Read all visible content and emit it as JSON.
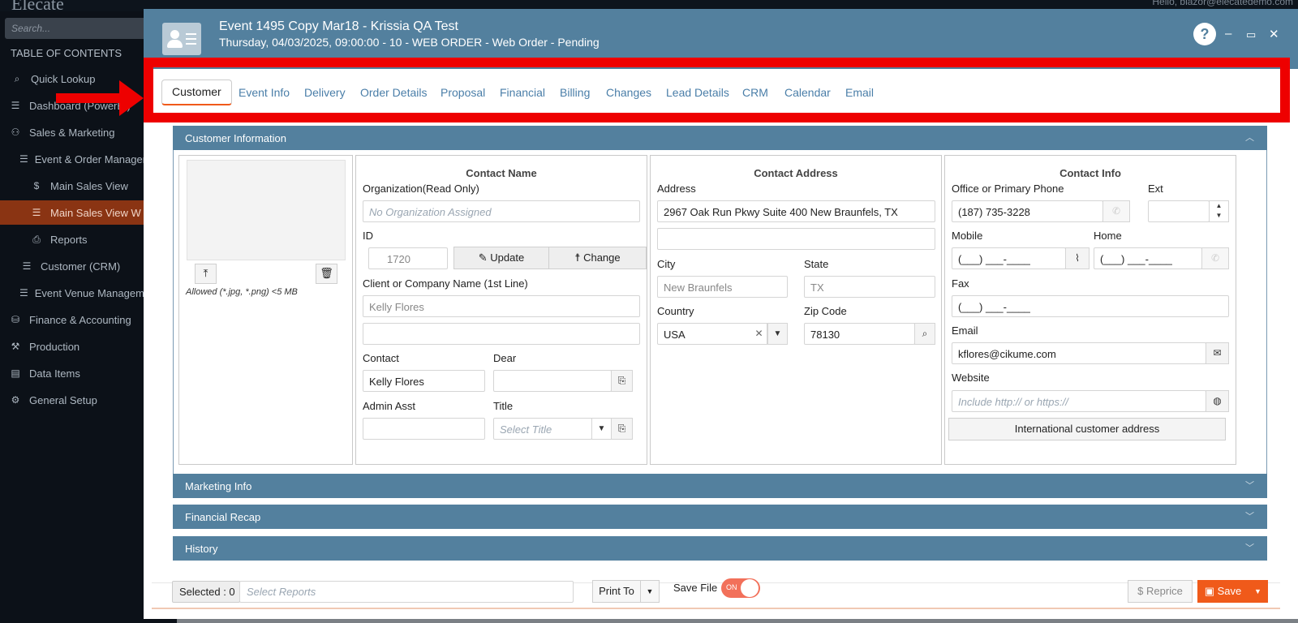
{
  "background": {
    "logo": "Elecate",
    "user": "Hello, blazor@elecatedemo.com",
    "search_placeholder": "Search...",
    "toc_title": "TABLE OF CONTENTS",
    "nav": [
      {
        "label": "Quick Lookup",
        "icon": "search-icon"
      },
      {
        "label": "Dashboard (PowerBI)",
        "icon": "list-icon"
      },
      {
        "label": "Sales & Marketing",
        "icon": "people-icon"
      },
      {
        "label": "Event & Order Management",
        "icon": "list-icon"
      },
      {
        "label": "Main Sales View",
        "icon": "dollar-icon"
      },
      {
        "label": "Main Sales View W",
        "icon": "list-icon"
      },
      {
        "label": "Reports",
        "icon": "printer-icon"
      },
      {
        "label": "Customer (CRM)",
        "icon": "list-icon"
      },
      {
        "label": "Event Venue Management",
        "icon": "list-icon"
      },
      {
        "label": "Finance & Accounting",
        "icon": "bank-icon"
      },
      {
        "label": "Production",
        "icon": "tools-icon"
      },
      {
        "label": "Data Items",
        "icon": "database-icon"
      },
      {
        "label": "General Setup",
        "icon": "settings-icon"
      }
    ]
  },
  "header": {
    "title": "Event 1495 Copy Mar18 - Krissia QA Test",
    "subtitle": "Thursday, 04/03/2025, 09:00:00 - 10 - WEB ORDER - Web Order - Pending",
    "help": "?",
    "minimize": "–",
    "maximize": "▭",
    "close": "✕"
  },
  "tabs": [
    "Customer",
    "Event Info",
    "Delivery",
    "Order Details",
    "Proposal",
    "Financial",
    "Billing",
    "Changes",
    "Lead Details",
    "CRM",
    "Calendar",
    "Email"
  ],
  "sections": {
    "customer_info": "Customer Information",
    "marketing": "Marketing Info",
    "financial_recap": "Financial Recap",
    "history": "History"
  },
  "photo": {
    "allowed": "Allowed (*.jpg, *.png) <5 MB"
  },
  "contact_name": {
    "title": "Contact Name",
    "org_label": "Organization(Read Only)",
    "org_placeholder": "No Organization Assigned",
    "id_label": "ID",
    "id_value": "1720",
    "update_btn": "Update",
    "change_btn": "Change",
    "client_label": "Client or Company Name (1st Line)",
    "client_value": "Kelly Flores",
    "client_line2": "",
    "contact_label": "Contact",
    "contact_value": "Kelly Flores",
    "dear_label": "Dear",
    "dear_value": "",
    "admin_label": "Admin Asst",
    "admin_value": "",
    "title_label": "Title",
    "title_placeholder": "Select Title"
  },
  "contact_address": {
    "title": "Contact Address",
    "address_label": "Address",
    "address_value": "2967 Oak Run Pkwy Suite 400 New Braunfels, TX",
    "address_line2": "",
    "city_label": "City",
    "city_value": "New Braunfels",
    "state_label": "State",
    "state_value": "TX",
    "country_label": "Country",
    "country_value": "USA",
    "zip_label": "Zip Code",
    "zip_value": "78130"
  },
  "contact_info": {
    "title": "Contact Info",
    "phone_label": "Office or Primary Phone",
    "phone_value": "(187) 735-3228",
    "ext_label": "Ext",
    "ext_value": "",
    "mobile_label": "Mobile",
    "mobile_value": "(___) ___-____",
    "home_label": "Home",
    "home_value": "(___) ___-____",
    "fax_label": "Fax",
    "fax_value": "(___) ___-____",
    "email_label": "Email",
    "email_value": "kflores@cikume.com",
    "website_label": "Website",
    "website_placeholder": "Include http:// or https://",
    "intl_btn": "International customer address"
  },
  "footer": {
    "selected": "Selected : 0",
    "select_reports": "Select Reports",
    "print_to": "Print To",
    "save_file": "Save File",
    "toggle_state": "ON",
    "reprice": "Reprice",
    "save": "Save"
  },
  "colors": {
    "header": "#53809e",
    "accent": "#f05a1a",
    "highlight": "#ee0000"
  }
}
